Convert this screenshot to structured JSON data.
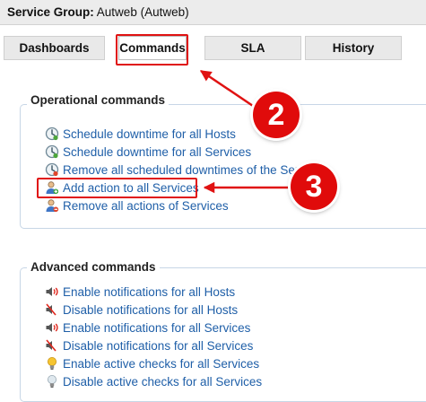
{
  "header": {
    "label": "Service Group:",
    "value": "Autweb (Autweb)"
  },
  "tabs": [
    {
      "label": "Dashboards",
      "active": false
    },
    {
      "label": "Commands",
      "active": true
    },
    {
      "label": "SLA",
      "active": false
    },
    {
      "label": "History",
      "active": false
    }
  ],
  "annotations": {
    "step_tab": "2",
    "step_add_action": "3",
    "highlight_color": "#e01212"
  },
  "operational": {
    "title": "Operational commands",
    "items": [
      {
        "label": "Schedule downtime for all Hosts",
        "icon": "clock-icon"
      },
      {
        "label": "Schedule downtime for all Services",
        "icon": "clock-icon"
      },
      {
        "label": "Remove all scheduled downtimes of the Servi",
        "icon": "clock-remove-icon"
      },
      {
        "label": "Add action to all Services",
        "icon": "user-add-icon"
      },
      {
        "label": "Remove all actions of Services",
        "icon": "user-remove-icon"
      }
    ]
  },
  "advanced": {
    "title": "Advanced commands",
    "items": [
      {
        "label": "Enable notifications for all Hosts",
        "icon": "speaker-on-icon"
      },
      {
        "label": "Disable notifications for all Hosts",
        "icon": "speaker-off-icon"
      },
      {
        "label": "Enable notifications for all Services",
        "icon": "speaker-on-icon"
      },
      {
        "label": "Disable notifications for all Services",
        "icon": "speaker-off-icon"
      },
      {
        "label": "Enable active checks for all Services",
        "icon": "bulb-on-icon"
      },
      {
        "label": "Disable active checks for all Services",
        "icon": "bulb-off-icon"
      }
    ]
  }
}
